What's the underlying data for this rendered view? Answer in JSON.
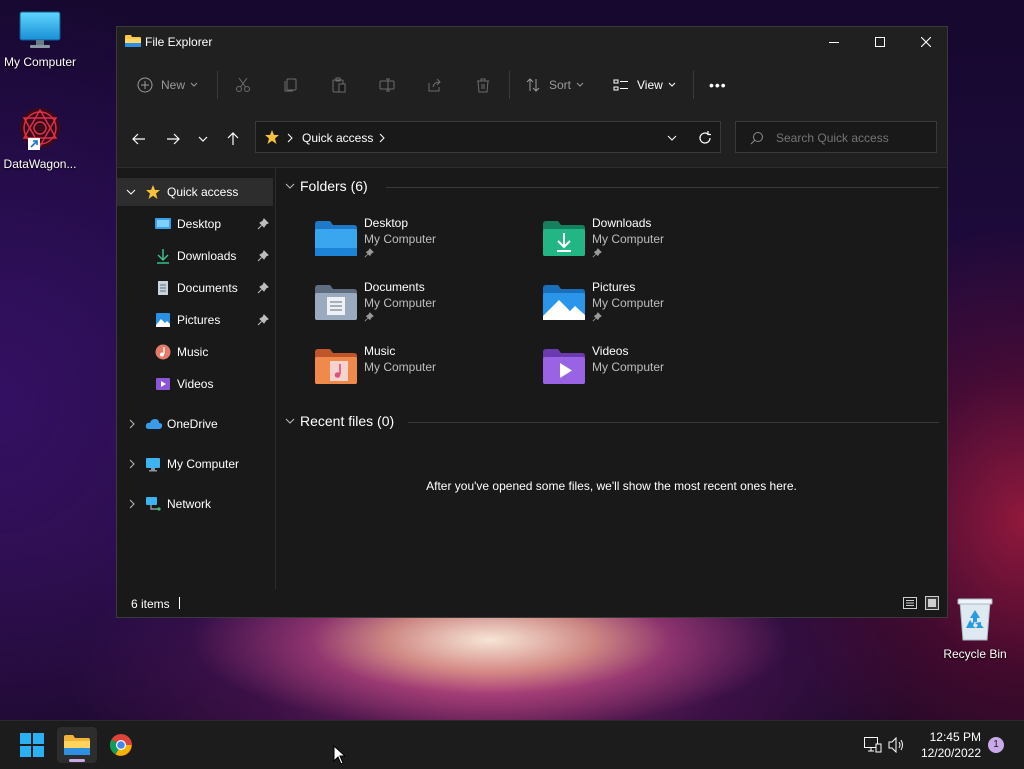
{
  "colors": {
    "accent": "#4cc2ff",
    "folder_yellow": "#f8c64a",
    "star": "#f8c33a",
    "pin": "#bdbdbd"
  },
  "desktop": {
    "icons": [
      {
        "label": "My Computer",
        "icon": "monitor-icon"
      },
      {
        "label": "DataWagon...",
        "icon": "datawagon-shortcut-icon"
      },
      {
        "label": "Recycle Bin",
        "icon": "recycle-bin-icon"
      }
    ]
  },
  "window": {
    "title": "File Explorer",
    "toolbar": {
      "new_label": "New",
      "sort_label": "Sort",
      "view_label": "View",
      "more_label": "•••"
    },
    "address": {
      "location": "Quick access"
    },
    "search": {
      "placeholder": "Search Quick access"
    },
    "sidebar": {
      "quick_access": "Quick access",
      "items": [
        {
          "label": "Desktop",
          "icon": "desktop-folder-icon",
          "pinned": true
        },
        {
          "label": "Downloads",
          "icon": "download-icon",
          "pinned": true
        },
        {
          "label": "Documents",
          "icon": "document-icon",
          "pinned": true
        },
        {
          "label": "Pictures",
          "icon": "pictures-icon",
          "pinned": true
        },
        {
          "label": "Music",
          "icon": "music-icon",
          "pinned": false
        },
        {
          "label": "Videos",
          "icon": "videos-icon",
          "pinned": false
        }
      ],
      "roots": [
        {
          "label": "OneDrive",
          "icon": "cloud-icon"
        },
        {
          "label": "My Computer",
          "icon": "computer-icon"
        },
        {
          "label": "Network",
          "icon": "network-icon"
        }
      ]
    },
    "content": {
      "folders_header": "Folders (6)",
      "folders": [
        {
          "name": "Desktop",
          "location": "My Computer",
          "pinned": true,
          "color": "#2f8fe0"
        },
        {
          "name": "Downloads",
          "location": "My Computer",
          "pinned": true,
          "color": "#1fa67a"
        },
        {
          "name": "Documents",
          "location": "My Computer",
          "pinned": true,
          "color": "#8a9bb0"
        },
        {
          "name": "Pictures",
          "location": "My Computer",
          "pinned": true,
          "color": "#2b8fe6"
        },
        {
          "name": "Music",
          "location": "My Computer",
          "pinned": false,
          "color": "#e57a3c"
        },
        {
          "name": "Videos",
          "location": "My Computer",
          "pinned": false,
          "color": "#8b55d8"
        }
      ],
      "recent_header": "Recent files (0)",
      "recent_empty": "After you've opened some files, we'll show the most recent ones here."
    },
    "status": {
      "items": "6 items"
    }
  },
  "taskbar": {
    "time": "12:45 PM",
    "date": "12/20/2022",
    "notifications": "1"
  }
}
